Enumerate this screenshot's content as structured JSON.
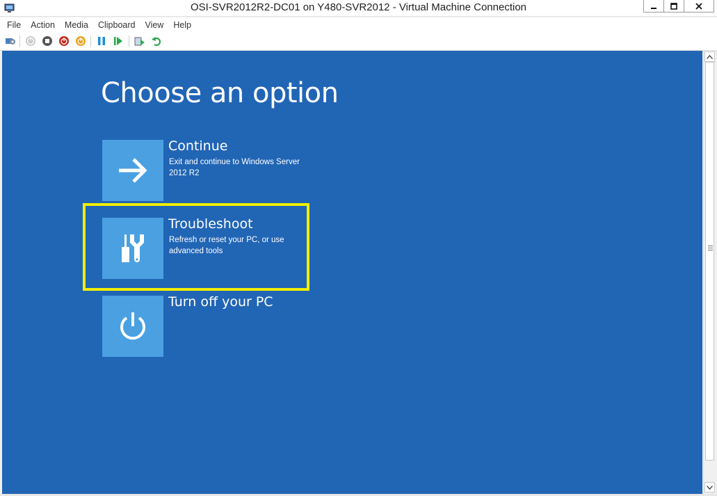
{
  "window": {
    "title": "OSI-SVR2012R2-DC01 on Y480-SVR2012 - Virtual Machine Connection",
    "controls": [
      "minimize",
      "maximize",
      "close"
    ]
  },
  "menu": {
    "items": [
      "File",
      "Action",
      "Media",
      "Clipboard",
      "View",
      "Help"
    ]
  },
  "toolbar": {
    "buttons": [
      "ctrl-alt-del-icon",
      "start-icon",
      "turn-off-icon",
      "shut-down-icon",
      "save-icon",
      "pause-icon",
      "reset-icon",
      "checkpoint-icon",
      "revert-icon"
    ]
  },
  "screen": {
    "heading": "Choose an option",
    "options": [
      {
        "title": "Continue",
        "description": "Exit and continue to Windows Server 2012 R2",
        "icon": "arrow-right-icon"
      },
      {
        "title": "Troubleshoot",
        "description": "Refresh or reset your PC, or use advanced tools",
        "icon": "tools-icon"
      },
      {
        "title": "Turn off your PC",
        "description": "",
        "icon": "power-icon"
      }
    ],
    "highlighted_option": "Troubleshoot",
    "colors": {
      "background": "#2165b5",
      "tile": "#4aa0e1",
      "highlight": "#f1ee00"
    }
  }
}
